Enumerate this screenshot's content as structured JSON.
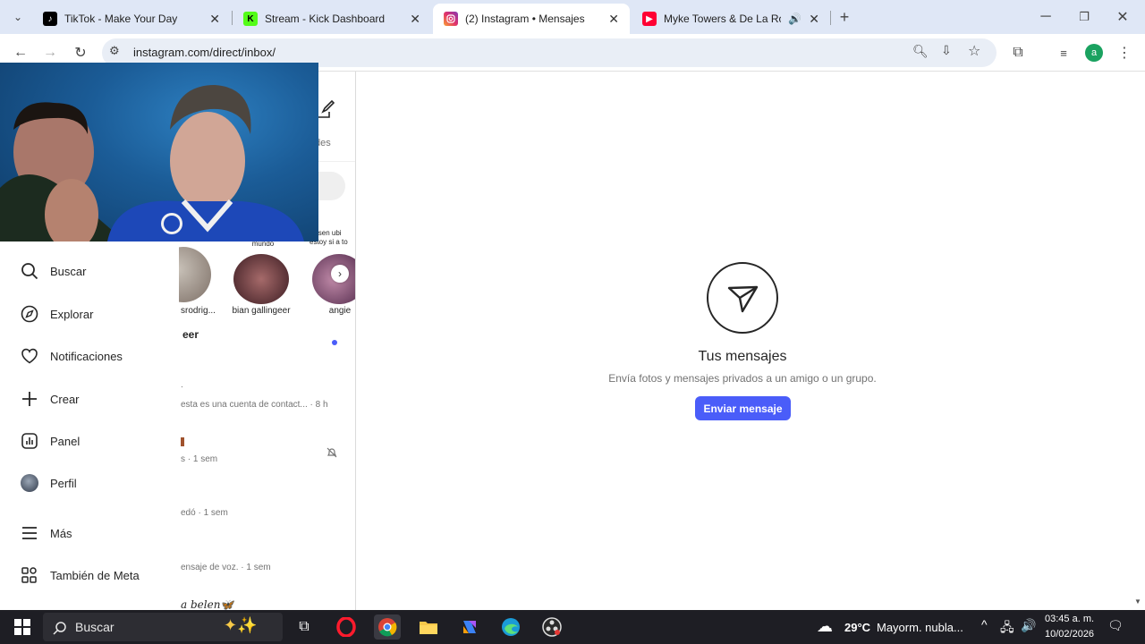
{
  "browser": {
    "tabs": [
      {
        "title": "TikTok - Make Your Day",
        "icon": "tiktok-icon",
        "active": false
      },
      {
        "title": "Stream - Kick Dashboard",
        "icon": "kick-icon",
        "active": false
      },
      {
        "title": "(2) Instagram • Mensajes",
        "icon": "instagram-icon",
        "active": true
      },
      {
        "title": "Myke Towers & De La Rose",
        "icon": "youtube-icon",
        "active": false
      }
    ],
    "url": "instagram.com/direct/inbox/",
    "profile_initial": "a"
  },
  "nav": {
    "items": [
      {
        "label": "Buscar",
        "icon": "search-icon"
      },
      {
        "label": "Explorar",
        "icon": "compass-icon"
      },
      {
        "label": "Notificaciones",
        "icon": "heart-icon"
      },
      {
        "label": "Crear",
        "icon": "plus-icon"
      },
      {
        "label": "Panel",
        "icon": "chart-icon"
      },
      {
        "label": "Perfil",
        "icon": "avatar"
      },
      {
        "label": "Más",
        "icon": "menu-icon"
      },
      {
        "label": "También de Meta",
        "icon": "meta-icon"
      }
    ]
  },
  "threads": {
    "header_fragment": "des",
    "notes": [
      {
        "text": "materias contra el mundo"
      },
      {
        "text": "Pasen ubi estoy si a to"
      }
    ],
    "stories": [
      {
        "name": "srodrig..."
      },
      {
        "name": "bian gallingeer"
      },
      {
        "name": "angie"
      }
    ],
    "rows": [
      {
        "name": "eer",
        "preview": ""
      },
      {
        "name": "",
        "preview": "esta es una cuenta de contact... · 8 h"
      },
      {
        "name": "",
        "preview": "s · 1 sem"
      },
      {
        "name": "",
        "preview": "edó · 1 sem"
      },
      {
        "name": "",
        "preview": "ensaje de voz. · 1 sem"
      },
      {
        "name": "a belen🦋",
        "preview": ""
      }
    ]
  },
  "main": {
    "title": "Tus mensajes",
    "subtitle": "Envía fotos y mensajes privados a un amigo o un grupo.",
    "button": "Enviar mensaje"
  },
  "taskbar": {
    "search_placeholder": "Buscar",
    "weather_temp": "29°C",
    "weather_text": "Mayorm. nubla...",
    "time": "03:45 a. m.",
    "date": "10/02/2026"
  },
  "colors": {
    "accent": "#4a5df9",
    "tabbar": "#dfe7f6",
    "taskbar": "#1e1e24"
  }
}
